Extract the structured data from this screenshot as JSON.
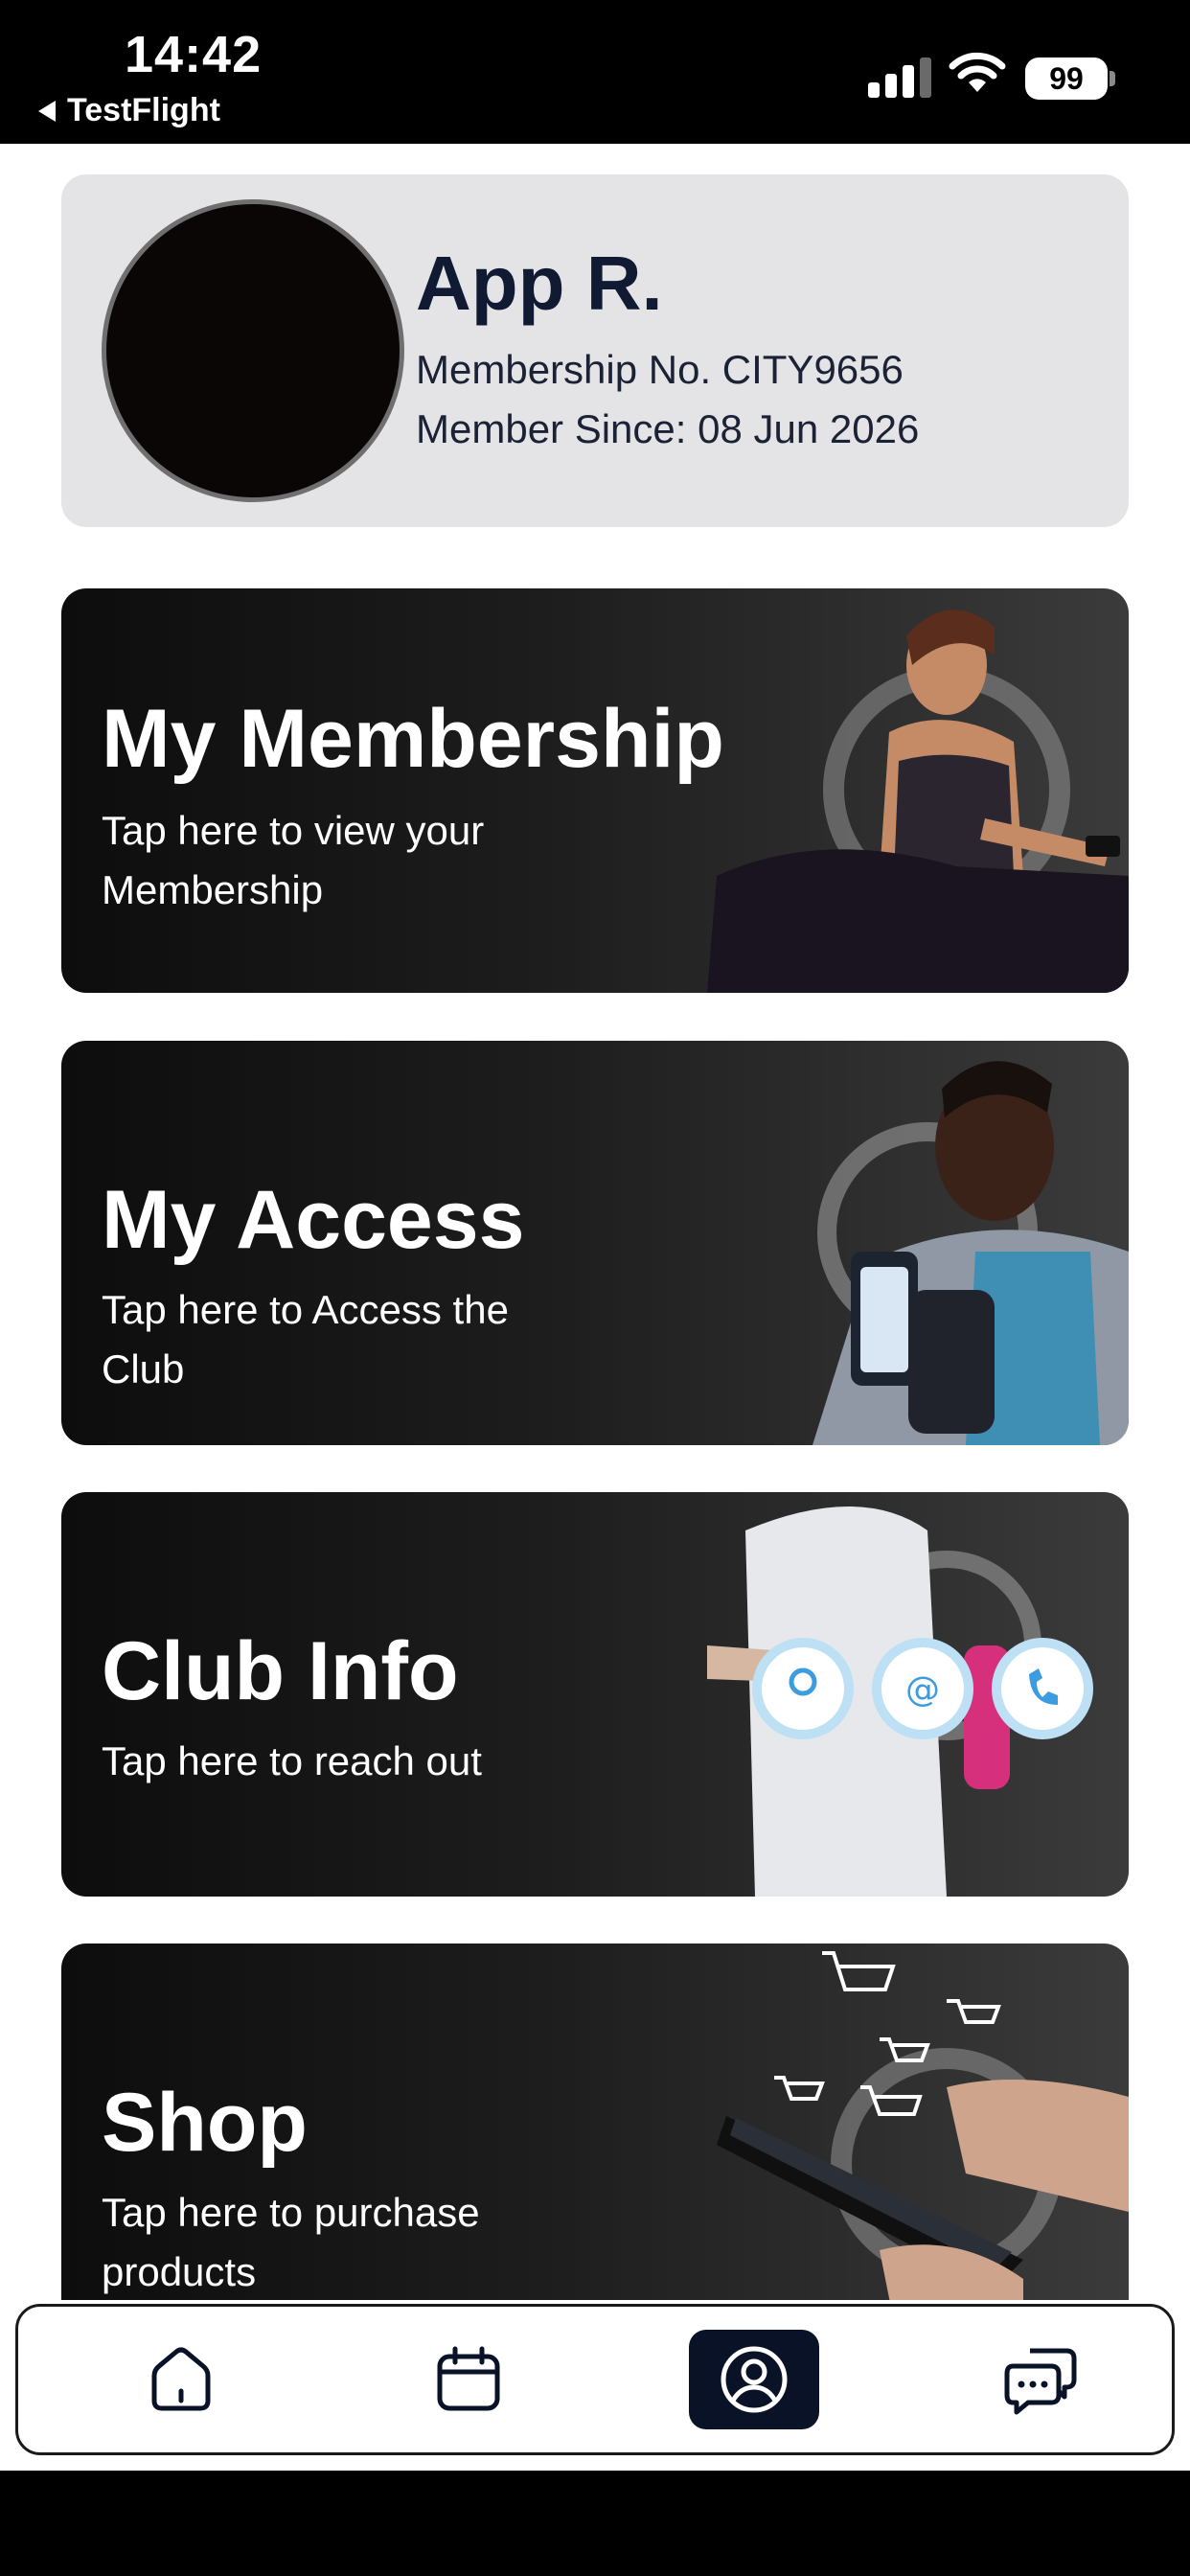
{
  "status_bar": {
    "time": "14:42",
    "back_app": "TestFlight",
    "battery": "99",
    "icons": [
      "signal-icon",
      "wifi-icon",
      "battery-icon"
    ]
  },
  "profile": {
    "name": "App R.",
    "membership_no": "Membership No. CITY9656",
    "member_since": "Member Since: 08 Jun 2026"
  },
  "cards": {
    "membership": {
      "title": "My Membership",
      "subtitle": "Tap here to view your Membership"
    },
    "access": {
      "title": "My Access",
      "subtitle": "Tap here to Access the Club"
    },
    "info": {
      "title": "Club Info",
      "subtitle": "Tap here to reach out"
    },
    "shop": {
      "title": "Shop",
      "subtitle": "Tap here to purchase products"
    }
  },
  "bottom_nav": {
    "items": [
      "home-icon",
      "calendar-icon",
      "profile-icon",
      "chat-icon"
    ],
    "active": "profile-icon"
  },
  "colors": {
    "accent": "#0a1228",
    "card_bg": "#1d1d1d",
    "profile_bg": "#e4e4e6"
  }
}
